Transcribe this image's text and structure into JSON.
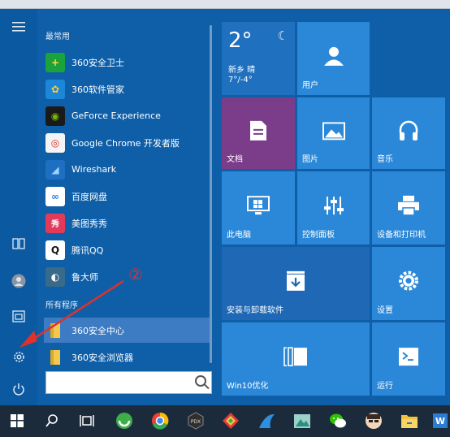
{
  "start_menu": {
    "groups": {
      "frequent": "最常用",
      "all_programs": "所有程序"
    },
    "frequent_apps": [
      {
        "label": "360安全卫士",
        "icon": "+",
        "color": "#1aa33a",
        "fg": "#ffd84a"
      },
      {
        "label": "360软件管家",
        "icon": "✿",
        "color": "#1c86d8",
        "fg": "#ffcc33"
      },
      {
        "label": "GeForce Experience",
        "icon": "◉",
        "color": "#1a1a1a",
        "fg": "#76b900"
      },
      {
        "label": "Google Chrome 开发者版",
        "icon": "◎",
        "color": "#f4f4f4",
        "fg": "#d93025"
      },
      {
        "label": "Wireshark",
        "icon": "◢",
        "color": "#1e6fc2",
        "fg": "#9fd3ff"
      },
      {
        "label": "百度网盘",
        "icon": "∞",
        "color": "#ffffff",
        "fg": "#2c7be5"
      },
      {
        "label": "美图秀秀",
        "icon": "秀",
        "color": "#e23a5a",
        "fg": "#ffffff"
      },
      {
        "label": "腾讯QQ",
        "icon": "Q",
        "color": "#ffffff",
        "fg": "#111111"
      },
      {
        "label": "鲁大师",
        "icon": "◐",
        "color": "#3a6a8a",
        "fg": "#ffffff"
      }
    ],
    "all_apps": [
      {
        "label": "360安全中心",
        "color": "#f2c94c",
        "selected": true
      },
      {
        "label": "360安全浏览器",
        "color": "#f2c94c",
        "selected": false
      }
    ],
    "search": {
      "placeholder": ""
    },
    "annotation": "②"
  },
  "rail_icons": [
    "menu-icon",
    "tablet-mode-icon",
    "user-icon",
    "documents-icon",
    "settings-icon",
    "power-icon"
  ],
  "tiles": {
    "weather": {
      "temp": "2°",
      "city": "新乡 晴",
      "range": "7°/-4°"
    },
    "user": "用户",
    "documents": "文档",
    "pictures": "图片",
    "music": "音乐",
    "this_pc": "此电脑",
    "control_panel": "控制面板",
    "devices_printers": "设备和打印机",
    "install_uninstall": "安装与卸载软件",
    "settings": "设置",
    "win10opt": "Win10优化",
    "run": "运行"
  },
  "taskbar_icons": [
    "windows-start-icon",
    "search-icon",
    "task-view-icon",
    "360-browser-icon",
    "chrome-icon",
    "app-icon",
    "gift-icon",
    "wireshark-icon",
    "photo-app-icon",
    "wechat-icon",
    "avatar-app-icon",
    "file-explorer-icon",
    "word-icon"
  ],
  "colors": {
    "accent": "#2b88d8",
    "start_bg": "#0f5fa8",
    "annotation": "#e0312b",
    "purple_tile": "#7b3d8a"
  }
}
